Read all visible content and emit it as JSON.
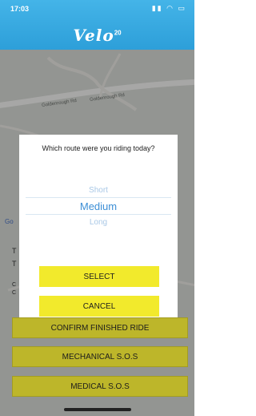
{
  "status_bar": {
    "time": "17:03",
    "icons": "signal wifi battery"
  },
  "header": {
    "logo": "Velo",
    "logo_sup": "20"
  },
  "map": {
    "road_labels": [
      "Goldenrough Rd",
      "Goldenrough Rd"
    ],
    "left_text": [
      "T",
      "T",
      "C",
      "C"
    ],
    "google": "Go"
  },
  "modal": {
    "question": "Which route were you riding today?",
    "options": [
      "Short",
      "Medium",
      "Long"
    ],
    "selected": "Medium",
    "select_label": "SELECT",
    "cancel_label": "CANCEL"
  },
  "actions": {
    "confirm_label": "CONFIRM FINISHED RIDE",
    "mechanical_label": "MECHANICAL S.O.S",
    "medical_label": "MEDICAL S.O.S"
  },
  "colors": {
    "header": "#2d9fd9",
    "modal_button": "#f2ea2c",
    "action_button": "#bdb62a",
    "picker_selected": "#3d8fd6",
    "picker_unselected": "#a9c8e6"
  }
}
